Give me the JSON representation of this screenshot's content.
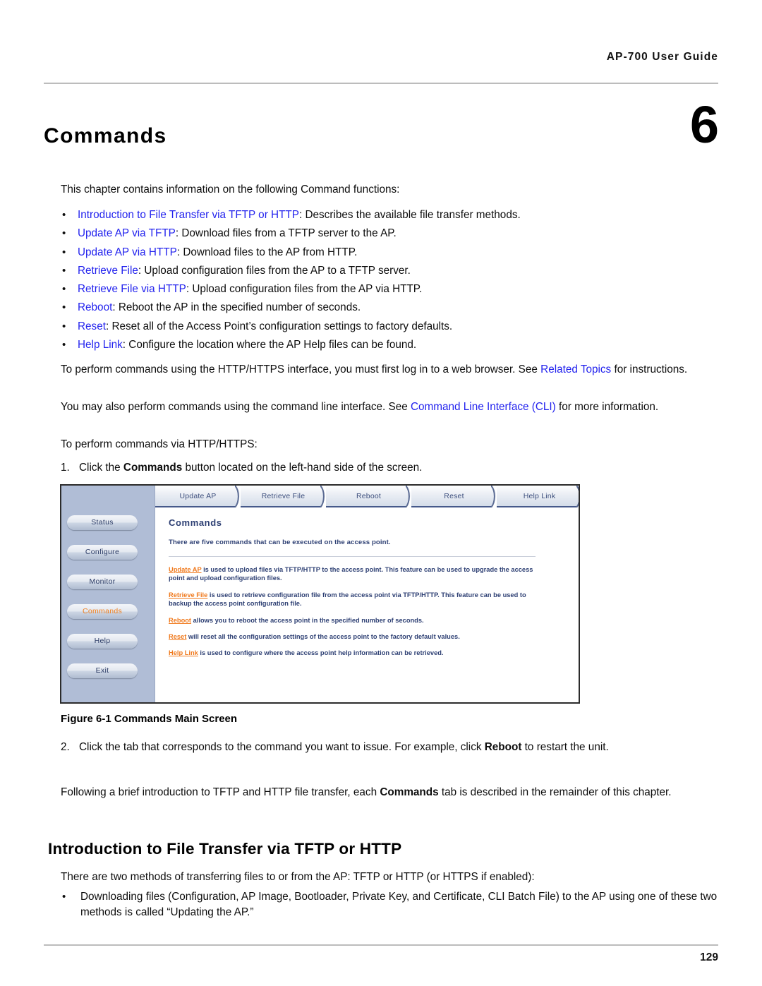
{
  "header": {
    "running_title": "AP-700 User Guide"
  },
  "chapter": {
    "title": "Commands",
    "number": "6"
  },
  "intro": {
    "lead": "This chapter contains information on the following Command functions:"
  },
  "bullets": [
    {
      "link": "Introduction to File Transfer via TFTP or HTTP",
      "rest": ": Describes the available file transfer methods."
    },
    {
      "link": "Update AP via TFTP",
      "rest": ": Download files from a TFTP server to the AP."
    },
    {
      "link": "Update AP via HTTP",
      "rest": ": Download files to the AP from HTTP."
    },
    {
      "link": "Retrieve File",
      "rest": ": Upload configuration files from the AP to a TFTP server."
    },
    {
      "link": "Retrieve File via HTTP",
      "rest": ": Upload configuration files from the AP via HTTP."
    },
    {
      "link": "Reboot",
      "rest": ": Reboot the AP in the specified number of seconds."
    },
    {
      "link": "Reset",
      "rest": ": Reset all of the Access Point’s configuration settings to factory defaults."
    },
    {
      "link": "Help Link",
      "rest": ": Configure the location where the AP Help files can be found."
    }
  ],
  "paragraphs": {
    "p1_before": "To perform commands using the HTTP/HTTPS interface, you must first log in to a web browser. See ",
    "p1_link": "Related Topics",
    "p1_after": " for instructions.",
    "p2_before": "You may also perform commands using the command line interface. See ",
    "p2_link": "Command Line Interface (CLI)",
    "p2_after": " for more information.",
    "p3": "To perform commands via HTTP/HTTPS:",
    "after_figure": "Following a brief introduction to TFTP and HTTP file transfer, each <b>Commands</b> tab is described in the remainder of this chapter."
  },
  "steps": [
    {
      "num": "1.",
      "html": "Click the <b>Commands</b> button located on the left-hand side of the screen."
    },
    {
      "num": "2.",
      "html": "Click the tab that corresponds to the command you want to issue. For example, click <b>Reboot</b> to restart the unit."
    }
  ],
  "figure": {
    "caption": "Figure 6-1 Commands Main Screen",
    "sidebar_buttons": [
      {
        "label": "Status",
        "active": false
      },
      {
        "label": "Configure",
        "active": false
      },
      {
        "label": "Monitor",
        "active": false
      },
      {
        "label": "Commands",
        "active": true
      },
      {
        "label": "Help",
        "active": false
      },
      {
        "label": "Exit",
        "active": false
      }
    ],
    "tabs": [
      {
        "label": "Update AP"
      },
      {
        "label": "Retrieve File"
      },
      {
        "label": "Reboot"
      },
      {
        "label": "Reset"
      },
      {
        "label": "Help Link"
      }
    ],
    "panel_title": "Commands",
    "panel_subtitle": "There are five commands that can be executed on the access point.",
    "panel_paragraphs": [
      {
        "link": "Update AP",
        "rest": " is used to upload files via TFTP/HTTP to the access point. This feature can be used to upgrade the access point and upload configuration files."
      },
      {
        "link": "Retrieve File",
        "rest": " is used to retrieve configuration file from the access point via TFTP/HTTP. This feature can be used to backup the access point configuration file."
      },
      {
        "link": "Reboot",
        "rest": " allows you to reboot the access point in the specified number of seconds."
      },
      {
        "link": "Reset",
        "rest": " will reset all the configuration settings of the access point to the factory default values."
      },
      {
        "link": "Help Link",
        "rest": " is used to configure where the access point help information can be retrieved."
      }
    ]
  },
  "section": {
    "heading": "Introduction to File Transfer via TFTP or HTTP",
    "intro": "There are two methods of transferring files to or from the AP: TFTP or HTTP (or HTTPS if enabled):",
    "bullets": [
      "Downloading files (Configuration, AP Image, Bootloader, Private Key, and Certificate, CLI Batch File) to the AP using one of these two methods is called “Updating the AP.”"
    ]
  },
  "footer": {
    "page_number": "129"
  },
  "colors": {
    "link_blue": "#2323ee",
    "screenshot_orange": "#f07a1e",
    "screenshot_navy": "#2d3f73",
    "sidebar_blue": "#b0bdd6",
    "rule_gray": "#bcbcbc"
  }
}
